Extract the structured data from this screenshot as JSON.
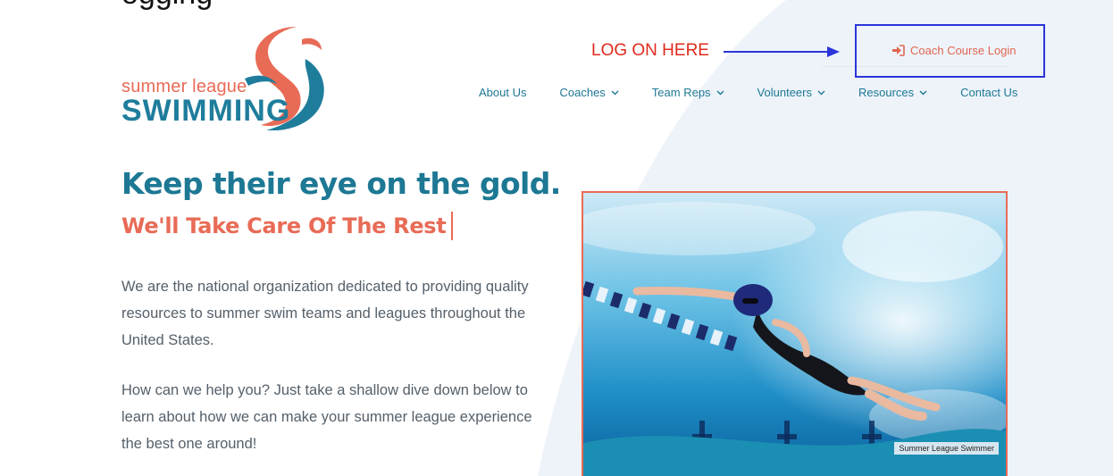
{
  "page": {
    "cut_text": "ogging"
  },
  "logo": {
    "line1": "summer league",
    "line2": "SWIMMING"
  },
  "annotation": {
    "text": "LOG ON HERE"
  },
  "header": {
    "login_label": "Coach Course Login"
  },
  "nav": {
    "items": [
      {
        "label": "About Us"
      },
      {
        "label": "Coaches"
      },
      {
        "label": "Team Reps"
      },
      {
        "label": "Volunteers"
      },
      {
        "label": "Resources"
      },
      {
        "label": "Contact Us"
      }
    ]
  },
  "hero": {
    "headline": "Keep their eye on the gold.",
    "subhead": "We'll Take Care Of The Rest",
    "paragraph1": "We are the national organization dedicated to providing quality resources to summer swim teams and leagues throughout the United States.",
    "paragraph2": "How can we help you? Just take a shallow dive down below to learn about how we can make your summer league experience the best one around!",
    "image_caption": "Summer League Swimmer"
  },
  "colors": {
    "brand_blue": "#1d7894",
    "brand_coral": "#e86b56",
    "annotation_red": "#e02a1c",
    "annotation_blue": "#2b35d8"
  }
}
